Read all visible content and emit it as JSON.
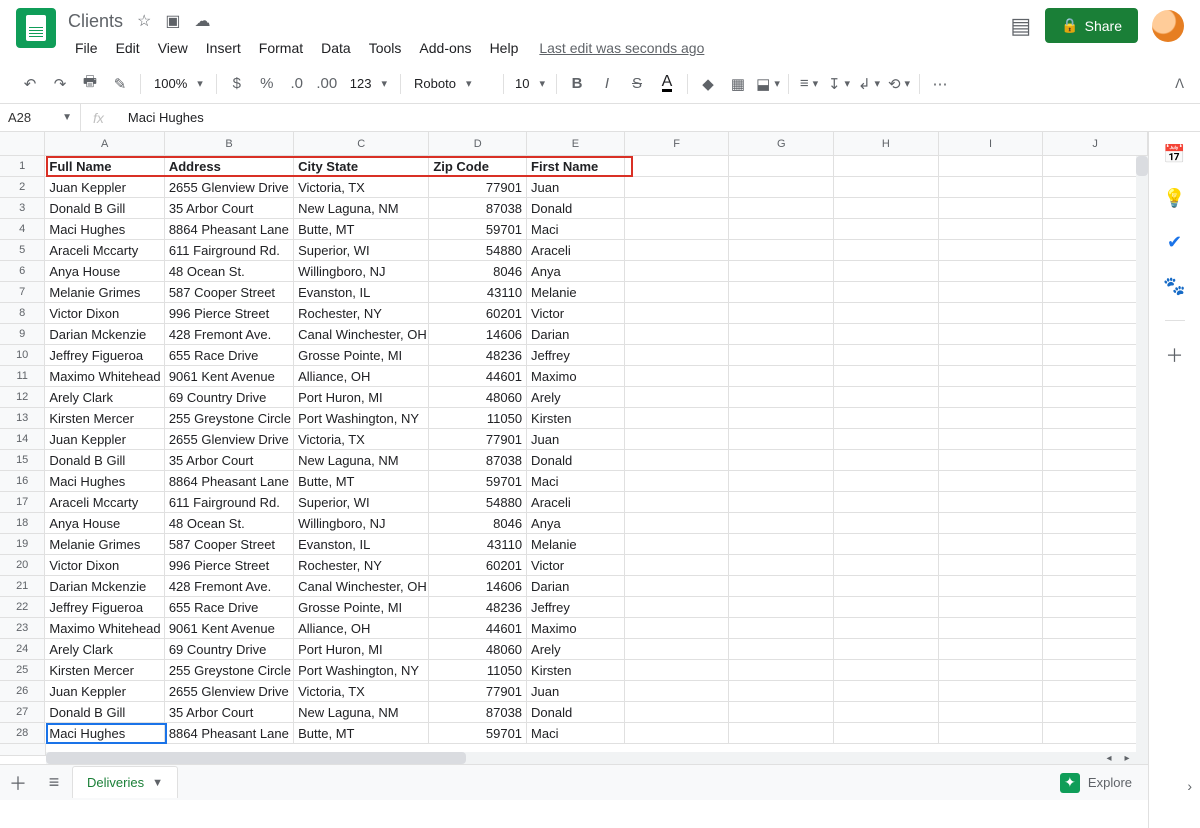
{
  "title": "Clients",
  "menu": [
    "File",
    "Edit",
    "View",
    "Insert",
    "Format",
    "Data",
    "Tools",
    "Add-ons",
    "Help"
  ],
  "last_edit": "Last edit was seconds ago",
  "share": "Share",
  "toolbar": {
    "zoom": "100%",
    "font": "Roboto",
    "fontsize": "10",
    "fmt": "123"
  },
  "namebox": "A28",
  "formula": "Maci Hughes",
  "cols": [
    "A",
    "B",
    "C",
    "D",
    "E",
    "F",
    "G",
    "H",
    "I",
    "J"
  ],
  "headers": [
    "Full Name",
    "Address",
    "City State",
    "Zip Code",
    "First Name"
  ],
  "rows": [
    [
      "Juan Keppler",
      "2655  Glenview Drive",
      "Victoria, TX",
      "77901",
      "Juan"
    ],
    [
      "Donald B Gill",
      "35  Arbor Court",
      "New Laguna, NM",
      "87038",
      "Donald"
    ],
    [
      "Maci Hughes",
      "8864 Pheasant Lane",
      "Butte, MT",
      "59701",
      "Maci"
    ],
    [
      "Araceli Mccarty",
      "611 Fairground Rd.",
      "Superior, WI",
      "54880",
      "Araceli"
    ],
    [
      "Anya House",
      "48 Ocean St.",
      "Willingboro, NJ",
      "8046",
      "Anya"
    ],
    [
      "Melanie Grimes",
      "587 Cooper Street",
      "Evanston, IL",
      "43110",
      "Melanie"
    ],
    [
      "Victor Dixon",
      "996 Pierce Street",
      "Rochester, NY",
      "60201",
      "Victor"
    ],
    [
      "Darian Mckenzie",
      "428 Fremont Ave.",
      "Canal Winchester, OH",
      "14606",
      "Darian"
    ],
    [
      "Jeffrey Figueroa",
      "655 Race Drive",
      "Grosse Pointe, MI",
      "48236",
      "Jeffrey"
    ],
    [
      "Maximo Whitehead",
      "9061 Kent Avenue",
      "Alliance, OH",
      "44601",
      "Maximo"
    ],
    [
      "Arely Clark",
      "69 Country Drive",
      "Port Huron, MI",
      "48060",
      "Arely"
    ],
    [
      "Kirsten Mercer",
      "255 Greystone Circle",
      "Port Washington, NY",
      "11050",
      "Kirsten"
    ],
    [
      "Juan Keppler",
      "2655  Glenview Drive",
      "Victoria, TX",
      "77901",
      "Juan"
    ],
    [
      "Donald B Gill",
      "35  Arbor Court",
      "New Laguna, NM",
      "87038",
      "Donald"
    ],
    [
      "Maci Hughes",
      "8864 Pheasant Lane",
      "Butte, MT",
      "59701",
      "Maci"
    ],
    [
      "Araceli Mccarty",
      "611 Fairground Rd.",
      "Superior, WI",
      "54880",
      "Araceli"
    ],
    [
      "Anya House",
      "48 Ocean St.",
      "Willingboro, NJ",
      "8046",
      "Anya"
    ],
    [
      "Melanie Grimes",
      "587 Cooper Street",
      "Evanston, IL",
      "43110",
      "Melanie"
    ],
    [
      "Victor Dixon",
      "996 Pierce Street",
      "Rochester, NY",
      "60201",
      "Victor"
    ],
    [
      "Darian Mckenzie",
      "428 Fremont Ave.",
      "Canal Winchester, OH",
      "14606",
      "Darian"
    ],
    [
      "Jeffrey Figueroa",
      "655 Race Drive",
      "Grosse Pointe, MI",
      "48236",
      "Jeffrey"
    ],
    [
      "Maximo Whitehead",
      "9061 Kent Avenue",
      "Alliance, OH",
      "44601",
      "Maximo"
    ],
    [
      "Arely Clark",
      "69 Country Drive",
      "Port Huron, MI",
      "48060",
      "Arely"
    ],
    [
      "Kirsten Mercer",
      "255 Greystone Circle",
      "Port Washington, NY",
      "11050",
      "Kirsten"
    ],
    [
      "Juan Keppler",
      "2655  Glenview Drive",
      "Victoria, TX",
      "77901",
      "Juan"
    ],
    [
      "Donald B Gill",
      "35  Arbor Court",
      "New Laguna, NM",
      "87038",
      "Donald"
    ],
    [
      "Maci Hughes",
      "8864 Pheasant Lane",
      "Butte, MT",
      "59701",
      "Maci"
    ]
  ],
  "sheet_tab": "Deliveries",
  "explore": "Explore",
  "selected_row": 28
}
